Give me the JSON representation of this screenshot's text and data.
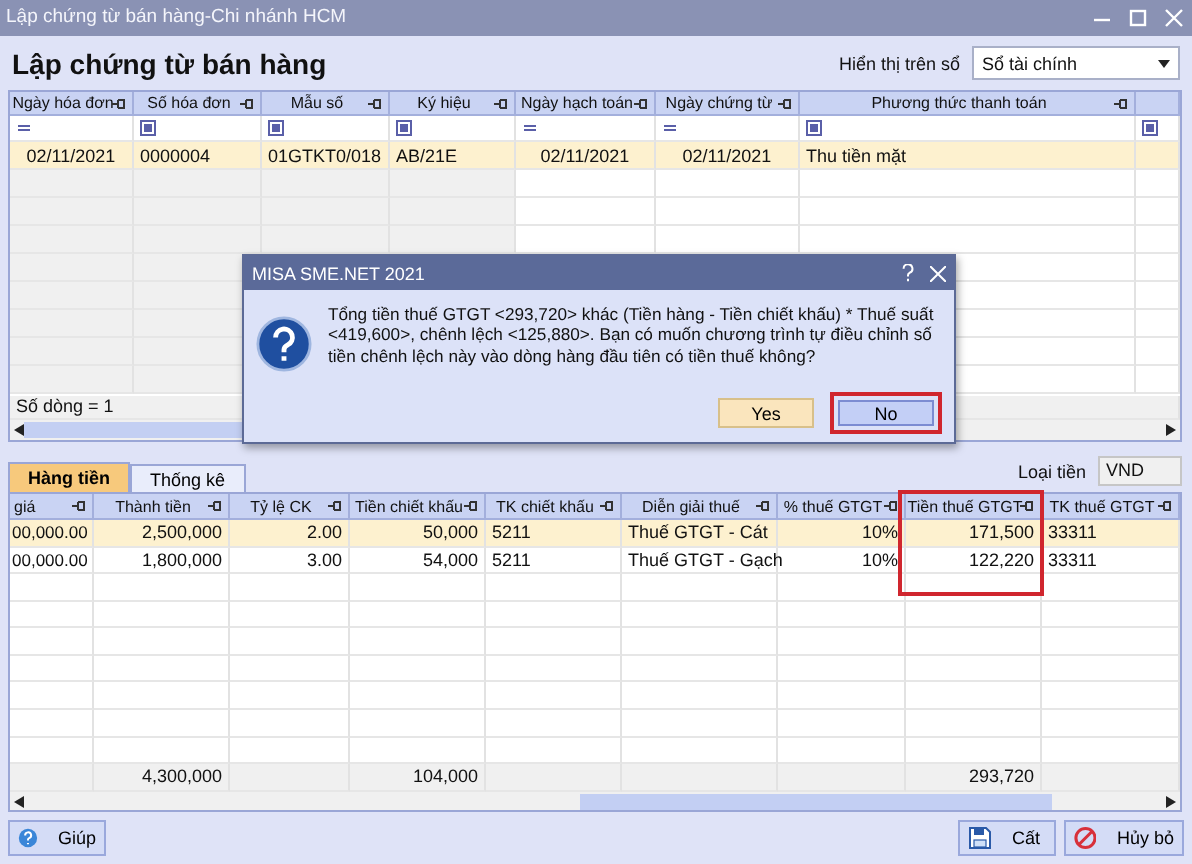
{
  "window": {
    "title": "Lập chứng từ bán hàng-Chi nhánh HCM"
  },
  "page_title": "Lập chứng từ bán hàng",
  "display_on": {
    "label": "Hiển thị trên sổ",
    "value": "Sổ tài chính"
  },
  "top_grid": {
    "columns": [
      {
        "label": "Ngày hóa đơn",
        "kind": "date"
      },
      {
        "label": "Số hóa đơn",
        "kind": "text"
      },
      {
        "label": "Mẫu số",
        "kind": "text"
      },
      {
        "label": "Ký hiệu",
        "kind": "text"
      },
      {
        "label": "Ngày hạch toán",
        "kind": "date"
      },
      {
        "label": "Ngày chứng từ",
        "kind": "date"
      },
      {
        "label": "Phương thức thanh toán",
        "kind": "text"
      },
      {}
    ],
    "filters": [
      {
        "kind": "equals"
      },
      {
        "kind": "box"
      },
      {
        "kind": "box"
      },
      {
        "kind": "box"
      },
      {
        "kind": "equals"
      },
      {
        "kind": "equals"
      },
      {
        "kind": "box"
      },
      {
        "kind": "box"
      }
    ],
    "rows": [
      {
        "selected": true,
        "cells": [
          "02/11/2021",
          "0000004",
          "01GTKT0/018",
          "AB/21E",
          "02/11/2021",
          "02/11/2021",
          "Thu tiền mặt"
        ]
      }
    ],
    "row_count": "Số dòng = 1"
  },
  "dialog": {
    "title": "MISA SME.NET 2021",
    "message": "Tổng tiền thuế GTGT <293,720> khác (Tiền hàng - Tiền chiết khấu) * Thuế suất <419,600>, chênh lệch <125,880>. Bạn có muốn chương trình tự điều chỉnh số tiền chênh lệch này vào dòng hàng đầu tiên có tiền thuế không?",
    "buttons": [
      {
        "label": "Yes",
        "selected": false,
        "highlighted": false
      },
      {
        "label": "No",
        "selected": true,
        "highlighted": true
      }
    ]
  },
  "tabs": [
    {
      "label": "Hàng tiền",
      "selected": true
    },
    {
      "label": "Thống kê",
      "selected": false
    }
  ],
  "currency": {
    "label": "Loại tiền",
    "value": "VND"
  },
  "bottom_grid": {
    "columns": [
      {
        "label": "giá",
        "highlighted": false
      },
      {
        "label": "Thành tiền",
        "kind": "number",
        "highlighted": false,
        "total": "4,300,000"
      },
      {
        "label": "Tỷ lệ CK",
        "kind": "number",
        "highlighted": false
      },
      {
        "label": "Tiền chiết khấu",
        "kind": "number",
        "highlighted": false,
        "total": "104,000"
      },
      {
        "label": "TK chiết khấu",
        "kind": "text",
        "highlighted": false
      },
      {
        "label": "Diễn giải thuế",
        "kind": "text",
        "highlighted": false
      },
      {
        "label": "% thuế GTGT",
        "kind": "number",
        "highlighted": false
      },
      {
        "label": "Tiền thuế GTGT",
        "kind": "number",
        "highlighted": true,
        "total": "293,720"
      },
      {
        "label": "TK thuế GTGT",
        "kind": "text",
        "highlighted": false
      }
    ],
    "rows": [
      {
        "selected": true,
        "cells": [
          "00,000.00",
          "2,500,000",
          "2.00",
          "50,000",
          "5211",
          "Thuế GTGT - Cát",
          "10%",
          "171,500",
          "33311"
        ]
      },
      {
        "selected": false,
        "cells": [
          "00,000.00",
          "1,800,000",
          "3.00",
          "54,000",
          "5211",
          "Thuế GTGT - Gạch",
          "10%",
          "122,220",
          "33311"
        ]
      }
    ]
  },
  "footer_buttons": [
    {
      "label": "Giúp",
      "kind": "help"
    },
    {
      "label": "Cất",
      "kind": "save"
    },
    {
      "label": "Hủy bỏ",
      "kind": "cancel"
    }
  ]
}
